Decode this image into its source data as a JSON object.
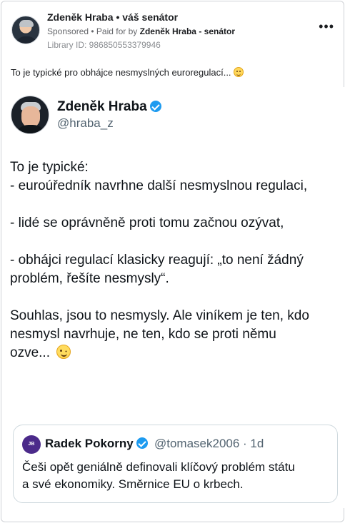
{
  "ad": {
    "page_name": "Zdeněk Hraba • váš senátor",
    "sponsored": "Sponsored",
    "paid_for_prefix": " • Paid for by ",
    "paid_for_by": "Zdeněk Hraba - senátor",
    "library_id": "Library ID: 986850553379946",
    "more_label": "•••",
    "caption": "To je typické pro obhájce nesmyslných euroregulací... "
  },
  "tweet": {
    "author_name": "Zdeněk Hraba",
    "author_handle": "@hraba_z",
    "lines": [
      "To je typické:",
      "- euroúředník navrhne další nesmyslnou regulaci,",
      "- lidé se oprávněně proti tomu začnou ozývat,",
      "- obhájci regulací klasicky reagují: „to není žádný",
      "problém, řešíte nesmysly“.",
      "Souhlas, jsou to nesmysly. Ale viníkem je ten, kdo",
      "nesmysl navrhuje, ne ten, kdo se proti němu",
      "ozve... "
    ]
  },
  "quote": {
    "avatar_text": "JB RVA",
    "author_name": "Radek Pokorny",
    "author_handle": "@tomasek2006 · 1d",
    "lines": [
      "Češi opět geniálně definovali klíčový problém státu",
      "a své ekonomiky. Směrnice EU o krbech."
    ]
  }
}
